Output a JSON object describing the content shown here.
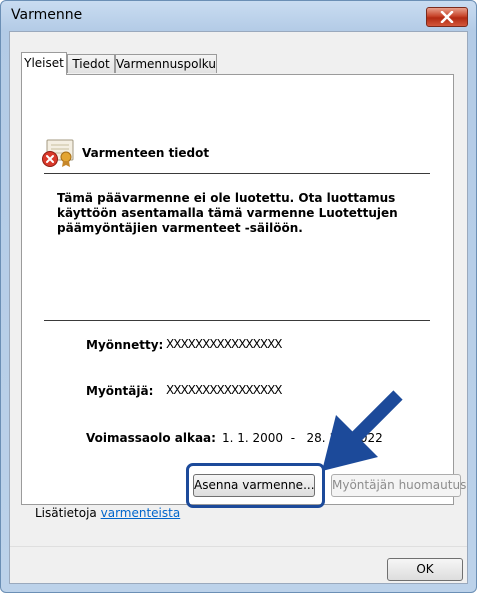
{
  "window": {
    "title": "Varmenne"
  },
  "tabs": [
    {
      "label": "Yleiset",
      "active": true
    },
    {
      "label": "Tiedot",
      "active": false
    },
    {
      "label": "Varmennuspolku",
      "active": false
    }
  ],
  "general": {
    "heading": "Varmenteen tiedot",
    "warning_text": "Tämä päävarmenne ei ole luotettu. Ota luottamus käyttöön asentamalla tämä varmenne Luotettujen päämyöntäjien varmenteet -säilöön.",
    "issued_to_label": "Myönnetty:",
    "issued_to_value": "XXXXXXXXXXXXXXXX",
    "issued_by_label": "Myöntäjä:",
    "issued_by_value": "XXXXXXXXXXXXXXXX",
    "valid_label": "Voimassaolo alkaa:",
    "valid_value": "1. 1. 2000  -   28. 10. 2022"
  },
  "buttons": {
    "install": "Asenna varmenne...",
    "issuer_statement": "Myöntäjän huomautus",
    "ok": "OK"
  },
  "more_info": {
    "prefix": "Lisätietoja",
    "link": "varmenteista"
  },
  "colors": {
    "highlight": "#1c4a9a",
    "link": "#0066cc",
    "close_button": "#c8452b"
  }
}
